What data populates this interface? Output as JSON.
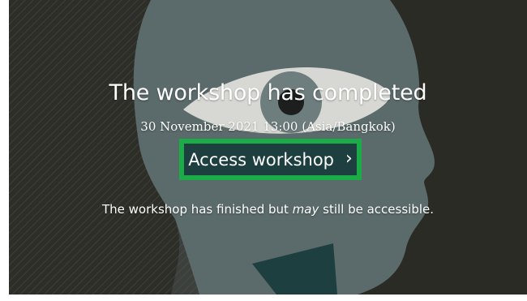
{
  "banner": {
    "title": "The workshop has completed",
    "datetime": "30 November 2021 13:00 (Asia/Bangkok)",
    "access_button": {
      "label": "Access workshop",
      "icon": "chevron-right-icon",
      "glyph": "›"
    },
    "note": {
      "before": "The workshop has finished but ",
      "emphasis": "may",
      "after": " still be accessible."
    }
  },
  "colors": {
    "background": "#2b2b26",
    "head": "#5c6b6b",
    "eye_white": "#d9d9d5",
    "button_bg": "#1e3f3f",
    "focus_ring": "#1bab47",
    "text": "#ffffff"
  }
}
